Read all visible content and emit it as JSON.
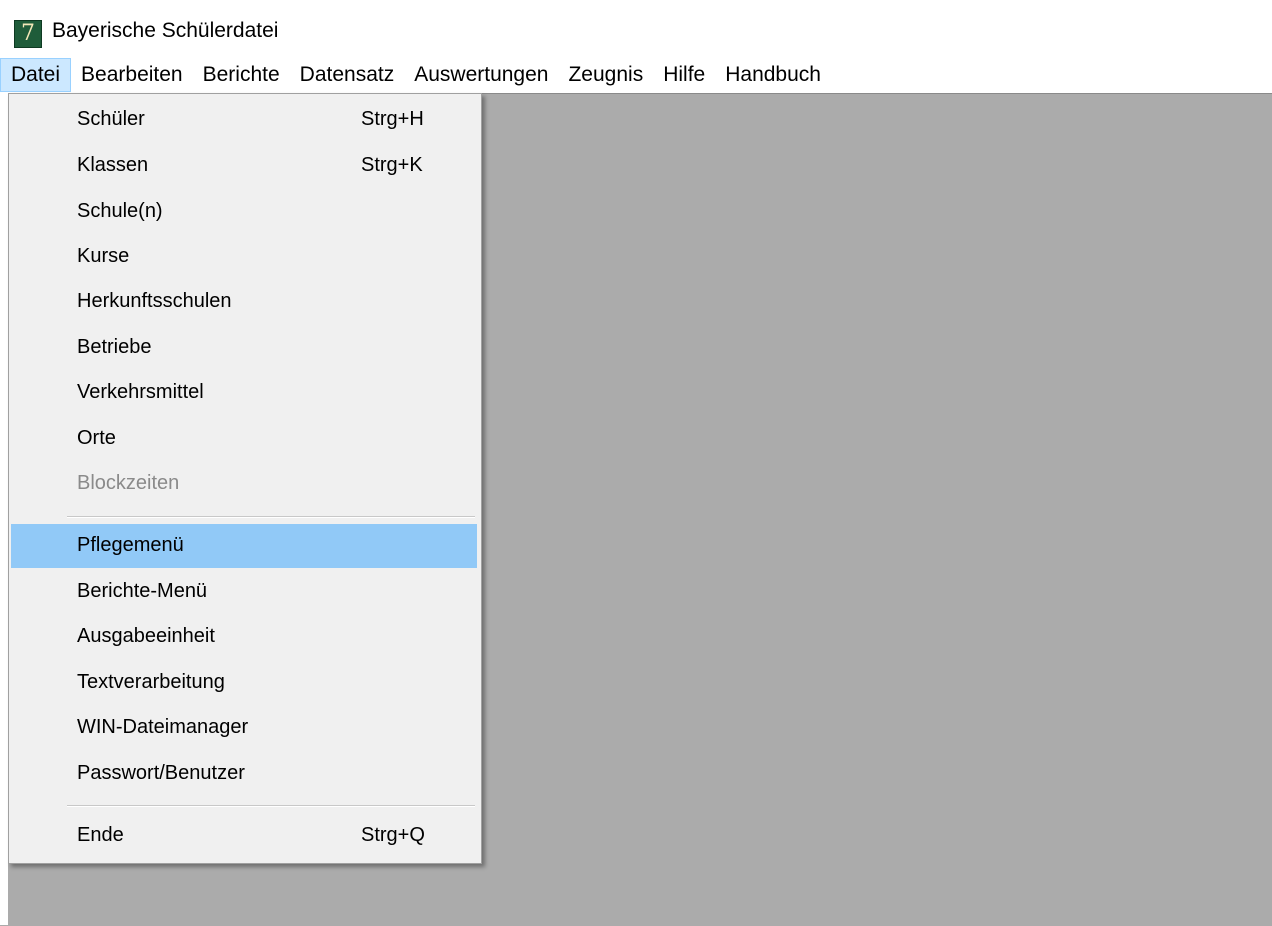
{
  "window": {
    "title": "Bayerische Schülerdatei",
    "icon_glyph": "7",
    "icon_name": "app-icon",
    "icon_color": "#1f5c3a"
  },
  "menubar": {
    "items": [
      "Datei",
      "Bearbeiten",
      "Berichte",
      "Datensatz",
      "Auswertungen",
      "Zeugnis",
      "Hilfe",
      "Handbuch"
    ],
    "active": "Datei"
  },
  "dropdown": {
    "items": [
      {
        "label": "Schüler",
        "shortcut": "Strg+H"
      },
      {
        "label": "Klassen",
        "shortcut": "Strg+K"
      },
      {
        "label": "Schule(n)",
        "shortcut": ""
      },
      {
        "label": "Kurse",
        "shortcut": ""
      },
      {
        "label": "Herkunftsschulen",
        "shortcut": ""
      },
      {
        "label": "Betriebe",
        "shortcut": ""
      },
      {
        "label": "Verkehrsmittel",
        "shortcut": ""
      },
      {
        "label": "Orte",
        "shortcut": ""
      },
      {
        "label": "Blockzeiten",
        "shortcut": "",
        "disabled": true
      },
      {
        "label": "Pflegemenü",
        "shortcut": "",
        "highlighted": true
      },
      {
        "label": "Berichte-Menü",
        "shortcut": ""
      },
      {
        "label": "Ausgabeeinheit",
        "shortcut": ""
      },
      {
        "label": "Textverarbeitung",
        "shortcut": ""
      },
      {
        "label": "WIN-Dateimanager",
        "shortcut": ""
      },
      {
        "label": "Passwort/Benutzer",
        "shortcut": ""
      },
      {
        "label": "Ende",
        "shortcut": "Strg+Q"
      }
    ]
  },
  "colors": {
    "highlight": "#91c9f7",
    "workspace": "#ababab",
    "menu_background": "#f0f0f0",
    "disabled_text": "#8a8a8a"
  }
}
